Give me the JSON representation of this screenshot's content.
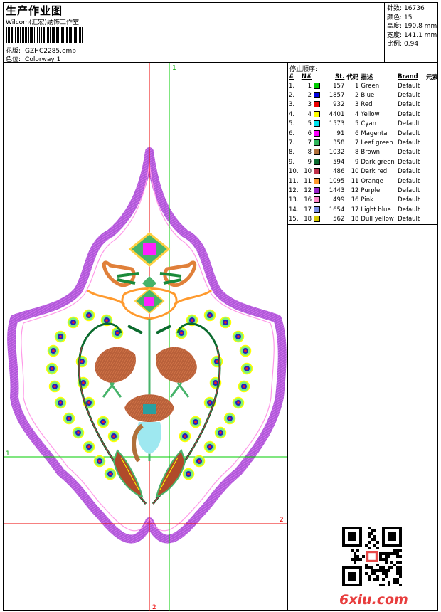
{
  "header": {
    "title": "生产作业图",
    "company": "Wilcom(汇宏)绣饰工作室",
    "design_label": "花版:",
    "design_value": "GZHC2285.emb",
    "colorway_label": "色位:",
    "colorway_value": "Colorway 1"
  },
  "stats": [
    {
      "label": "针数:",
      "value": "16736"
    },
    {
      "label": "颜色:",
      "value": "15"
    },
    {
      "label": "高度:",
      "value": "190.8 mm"
    },
    {
      "label": "宽度:",
      "value": "141.1 mm"
    },
    {
      "label": "比例:",
      "value": "0.94"
    }
  ],
  "stop_sequence": {
    "title": "停止顺序:",
    "headers": {
      "idx": "#",
      "no": "N#",
      "st": "St.",
      "code": "代码",
      "desc": "描述",
      "brand": "Brand",
      "elem": "元素"
    },
    "rows": [
      {
        "idx": "1.",
        "no": "1",
        "color": "#00cc00",
        "st": "157",
        "code": "1",
        "desc": "Green",
        "brand": "Default"
      },
      {
        "idx": "2.",
        "no": "2",
        "color": "#0000dd",
        "st": "1857",
        "code": "2",
        "desc": "Blue",
        "brand": "Default"
      },
      {
        "idx": "3.",
        "no": "3",
        "color": "#ee0000",
        "st": "932",
        "code": "3",
        "desc": "Red",
        "brand": "Default"
      },
      {
        "idx": "4.",
        "no": "4",
        "color": "#ffff00",
        "st": "4401",
        "code": "4",
        "desc": "Yellow",
        "brand": "Default"
      },
      {
        "idx": "5.",
        "no": "5",
        "color": "#00e5ee",
        "st": "1573",
        "code": "5",
        "desc": "Cyan",
        "brand": "Default"
      },
      {
        "idx": "6.",
        "no": "6",
        "color": "#ff00ff",
        "st": "91",
        "code": "6",
        "desc": "Magenta",
        "brand": "Default"
      },
      {
        "idx": "7.",
        "no": "7",
        "color": "#2fb55a",
        "st": "358",
        "code": "7",
        "desc": "Leaf green",
        "brand": "Default"
      },
      {
        "idx": "8.",
        "no": "8",
        "color": "#b0703a",
        "st": "1032",
        "code": "8",
        "desc": "Brown",
        "brand": "Default"
      },
      {
        "idx": "9.",
        "no": "9",
        "color": "#0b6b2e",
        "st": "594",
        "code": "9",
        "desc": "Dark green",
        "brand": "Default"
      },
      {
        "idx": "10.",
        "no": "10",
        "color": "#c0304a",
        "st": "486",
        "code": "10",
        "desc": "Dark red",
        "brand": "Default"
      },
      {
        "idx": "11.",
        "no": "11",
        "color": "#ff9a2e",
        "st": "1095",
        "code": "11",
        "desc": "Orange",
        "brand": "Default"
      },
      {
        "idx": "12.",
        "no": "12",
        "color": "#9a20c8",
        "st": "1443",
        "code": "12",
        "desc": "Purple",
        "brand": "Default"
      },
      {
        "idx": "13.",
        "no": "16",
        "color": "#ff88cc",
        "st": "499",
        "code": "16",
        "desc": "Pink",
        "brand": "Default"
      },
      {
        "idx": "14.",
        "no": "17",
        "color": "#7a90e8",
        "st": "1654",
        "code": "17",
        "desc": "Light blue",
        "brand": "Default"
      },
      {
        "idx": "15.",
        "no": "18",
        "color": "#d4c800",
        "st": "562",
        "code": "18",
        "desc": "Dull yellow",
        "brand": "Default"
      }
    ]
  },
  "canvas": {
    "marker_top": "1",
    "marker_left": "1",
    "marker_right": "2",
    "marker_bottom": "2",
    "guide_red": "#ee0000",
    "guide_green": "#00cc00"
  },
  "watermark": "6xiu.com",
  "icons": {
    "qr": "qr-code-icon"
  }
}
